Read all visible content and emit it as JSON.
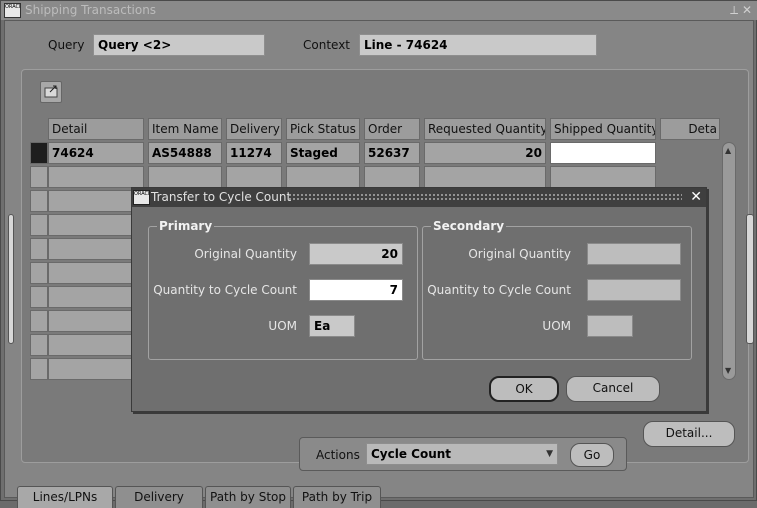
{
  "window": {
    "title": "Shipping Transactions",
    "controls": "⟂ ✕"
  },
  "header": {
    "query_label": "Query",
    "query_value": "Query <2>",
    "context_label": "Context",
    "context_value": "Line - 74624"
  },
  "grid": {
    "columns": [
      "Detail",
      "Item Name",
      "Delivery",
      "Pick Status",
      "Order",
      "Requested Quantity",
      "Shipped Quantity",
      "Deta"
    ],
    "rows": [
      {
        "detail": "74624",
        "item_name": "AS54888",
        "delivery": "11274",
        "pick_status": "Staged",
        "order": "52637",
        "requested_quantity": "20",
        "shipped_quantity": ""
      }
    ]
  },
  "actions": {
    "label": "Actions",
    "selected": "Cycle Count",
    "go_label": "Go",
    "detail_label": "Detail..."
  },
  "tabs": [
    "Lines/LPNs",
    "Delivery",
    "Path by Stop",
    "Path by Trip"
  ],
  "dialog": {
    "title": "Transfer to Cycle Count",
    "primary": {
      "title": "Primary",
      "original_quantity_label": "Original Quantity",
      "original_quantity": "20",
      "cycle_count_label": "Quantity to Cycle Count",
      "cycle_count": "7",
      "uom_label": "UOM",
      "uom": "Ea"
    },
    "secondary": {
      "title": "Secondary",
      "original_quantity_label": "Original Quantity",
      "cycle_count_label": "Quantity to Cycle Count",
      "uom_label": "UOM"
    },
    "ok_label": "OK",
    "cancel_label": "Cancel"
  }
}
